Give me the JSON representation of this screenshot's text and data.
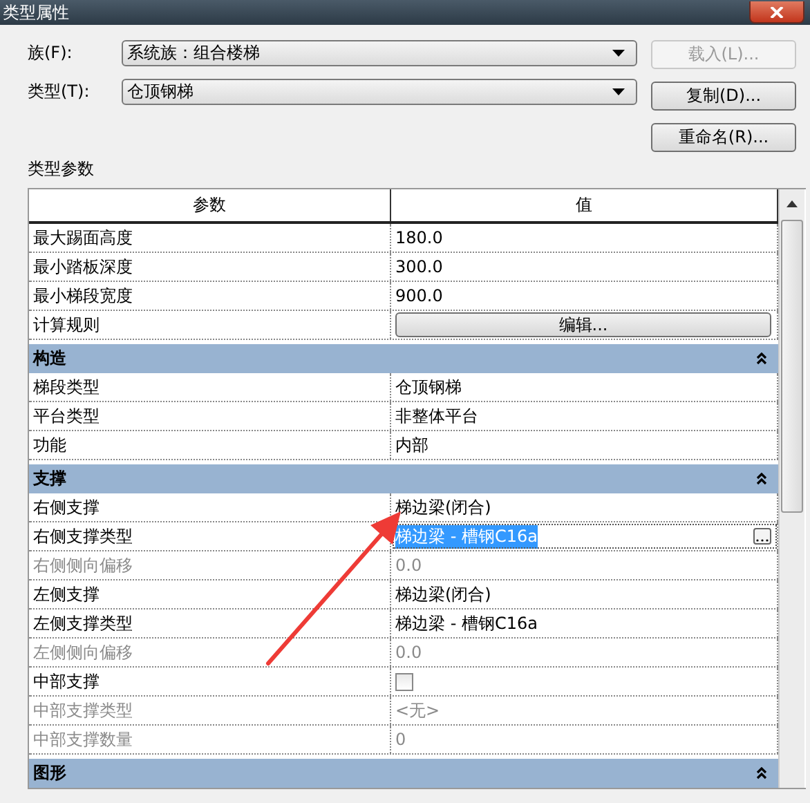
{
  "window": {
    "title": "类型属性"
  },
  "family": {
    "label": "族(F):",
    "value": "系统族：组合楼梯"
  },
  "type": {
    "label": "类型(T):",
    "value": "仓顶钢梯"
  },
  "buttons": [
    {
      "label": "载入(L)...",
      "disabled": true
    },
    {
      "label": "复制(D)...",
      "disabled": false
    },
    {
      "label": "重命名(R)...",
      "disabled": false
    }
  ],
  "section_label": "类型参数",
  "table": {
    "columns": [
      "参数",
      "值"
    ],
    "groups": [
      {
        "rows": [
          {
            "kind": "text",
            "name": "最大踢面高度",
            "value": "180.0",
            "disabled": false,
            "selected": false
          },
          {
            "kind": "text",
            "name": "最小踏板深度",
            "value": "300.0",
            "disabled": false,
            "selected": false
          },
          {
            "kind": "text",
            "name": "最小梯段宽度",
            "value": "900.0",
            "disabled": false,
            "selected": false
          },
          {
            "kind": "button",
            "name": "计算规则",
            "value": "编辑...",
            "disabled": false,
            "selected": false
          }
        ]
      },
      {
        "name": "构造",
        "expanded": true,
        "rows": [
          {
            "kind": "text",
            "name": "梯段类型",
            "value": "仓顶钢梯",
            "disabled": false,
            "selected": false
          },
          {
            "kind": "text",
            "name": "平台类型",
            "value": "非整体平台",
            "disabled": false,
            "selected": false
          },
          {
            "kind": "text",
            "name": "功能",
            "value": "内部",
            "disabled": false,
            "selected": false
          }
        ]
      },
      {
        "name": "支撑",
        "expanded": true,
        "rows": [
          {
            "kind": "text",
            "name": "右侧支撑",
            "value": "梯边梁(闭合)",
            "disabled": false,
            "selected": false
          },
          {
            "kind": "text",
            "name": "右侧支撑类型",
            "value": "梯边梁 - 槽钢C16a",
            "disabled": false,
            "selected": true
          },
          {
            "kind": "text",
            "name": "右侧侧向偏移",
            "value": "0.0",
            "disabled": true,
            "selected": false
          },
          {
            "kind": "text",
            "name": "左侧支撑",
            "value": "梯边梁(闭合)",
            "disabled": false,
            "selected": false
          },
          {
            "kind": "text",
            "name": "左侧支撑类型",
            "value": "梯边梁 - 槽钢C16a",
            "disabled": false,
            "selected": false
          },
          {
            "kind": "text",
            "name": "左侧侧向偏移",
            "value": "0.0",
            "disabled": true,
            "selected": false
          },
          {
            "kind": "checkbox",
            "name": "中部支撑",
            "checked": false,
            "disabled": false,
            "selected": false
          },
          {
            "kind": "text",
            "name": "中部支撑类型",
            "value": "<无>",
            "disabled": true,
            "selected": false
          },
          {
            "kind": "text",
            "name": "中部支撑数量",
            "value": "0",
            "disabled": true,
            "selected": false
          }
        ]
      },
      {
        "name": "图形",
        "expanded": true
      }
    ]
  }
}
